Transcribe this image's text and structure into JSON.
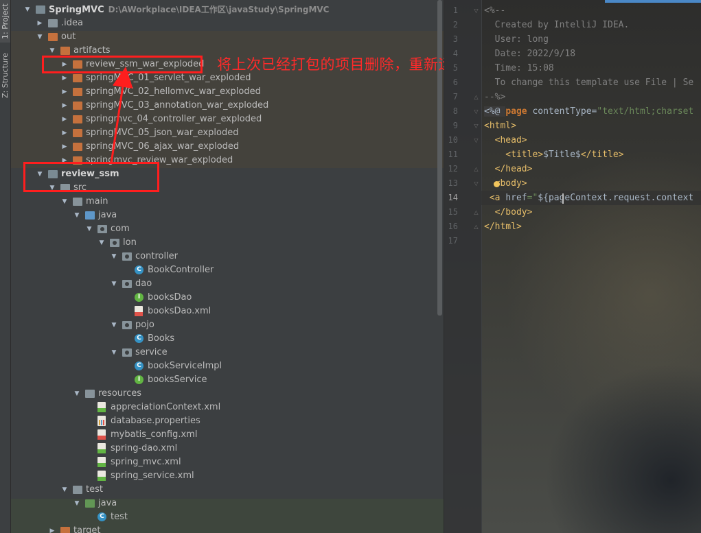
{
  "toolstrip": {
    "project_tab": "1: Project",
    "structure_tab": "Z: Structure"
  },
  "tree": {
    "rows": [
      {
        "label": "SpringMVC",
        "path": "D:\\AWorkplace\\IDEA工作区\\javaStudy\\SpringMVC",
        "kind": "module",
        "depth": 0,
        "expanded": true,
        "bold": true
      },
      {
        "label": ".idea",
        "kind": "folder",
        "depth": 1,
        "expanded": false
      },
      {
        "label": "out",
        "kind": "folder-orange",
        "depth": 1,
        "expanded": true
      },
      {
        "label": "artifacts",
        "kind": "folder-orange",
        "depth": 2,
        "expanded": true
      },
      {
        "label": "review_ssm_war_exploded",
        "kind": "folder-orange",
        "depth": 3,
        "expanded": false
      },
      {
        "label": "springMVC_01_servlet_war_exploded",
        "kind": "folder-orange",
        "depth": 3,
        "expanded": false
      },
      {
        "label": "springMVC_02_hellomvc_war_exploded",
        "kind": "folder-orange",
        "depth": 3,
        "expanded": false
      },
      {
        "label": "springMVC_03_annotation_war_exploded",
        "kind": "folder-orange",
        "depth": 3,
        "expanded": false
      },
      {
        "label": "springmvc_04_controller_war_exploded",
        "kind": "folder-orange",
        "depth": 3,
        "expanded": false
      },
      {
        "label": "springMVC_05_json_war_exploded",
        "kind": "folder-orange",
        "depth": 3,
        "expanded": false
      },
      {
        "label": "springMVC_06_ajax_war_exploded",
        "kind": "folder-orange",
        "depth": 3,
        "expanded": false
      },
      {
        "label": "springmvc_review_war_exploded",
        "kind": "folder-orange",
        "depth": 3,
        "expanded": false
      },
      {
        "label": "review_ssm",
        "kind": "module",
        "depth": 1,
        "expanded": true,
        "bold": true
      },
      {
        "label": "src",
        "kind": "folder",
        "depth": 2,
        "expanded": true
      },
      {
        "label": "main",
        "kind": "folder",
        "depth": 3,
        "expanded": true
      },
      {
        "label": "java",
        "kind": "folder-blue",
        "depth": 4,
        "expanded": true
      },
      {
        "label": "com",
        "kind": "package",
        "depth": 5,
        "expanded": true
      },
      {
        "label": "lon",
        "kind": "package",
        "depth": 6,
        "expanded": true
      },
      {
        "label": "controller",
        "kind": "package",
        "depth": 7,
        "expanded": true
      },
      {
        "label": "BookController",
        "kind": "class",
        "depth": 8
      },
      {
        "label": "dao",
        "kind": "package",
        "depth": 7,
        "expanded": true
      },
      {
        "label": "booksDao",
        "kind": "interface",
        "depth": 8
      },
      {
        "label": "booksDao.xml",
        "kind": "xml",
        "depth": 8
      },
      {
        "label": "pojo",
        "kind": "package",
        "depth": 7,
        "expanded": true
      },
      {
        "label": "Books",
        "kind": "class",
        "depth": 8
      },
      {
        "label": "service",
        "kind": "package",
        "depth": 7,
        "expanded": true
      },
      {
        "label": "bookServiceImpl",
        "kind": "class",
        "depth": 8
      },
      {
        "label": "booksService",
        "kind": "interface",
        "depth": 8
      },
      {
        "label": "resources",
        "kind": "folder-res",
        "depth": 4,
        "expanded": true
      },
      {
        "label": "appreciationContext.xml",
        "kind": "spring-xml",
        "depth": 5
      },
      {
        "label": "database.properties",
        "kind": "properties",
        "depth": 5
      },
      {
        "label": "mybatis_config.xml",
        "kind": "xml",
        "depth": 5
      },
      {
        "label": "spring-dao.xml",
        "kind": "spring-xml",
        "depth": 5
      },
      {
        "label": "spring_mvc.xml",
        "kind": "spring-xml",
        "depth": 5
      },
      {
        "label": "spring_service.xml",
        "kind": "spring-xml",
        "depth": 5
      },
      {
        "label": "test",
        "kind": "folder",
        "depth": 3,
        "expanded": true
      },
      {
        "label": "java",
        "kind": "folder-green",
        "depth": 4,
        "expanded": true
      },
      {
        "label": "test",
        "kind": "class",
        "depth": 5
      },
      {
        "label": "target",
        "kind": "folder-orange",
        "depth": 2,
        "expanded": false
      }
    ]
  },
  "annotation": {
    "text": "将上次已经打包的项目删除，重新运行项目打包"
  },
  "editor": {
    "lines": [
      {
        "n": "1",
        "tokens": [
          {
            "t": "<%--",
            "c": "c-comment"
          }
        ]
      },
      {
        "n": "2",
        "tokens": [
          {
            "t": "  Created by IntelliJ IDEA.",
            "c": "c-comment"
          }
        ]
      },
      {
        "n": "3",
        "tokens": [
          {
            "t": "  User: long",
            "c": "c-comment"
          }
        ]
      },
      {
        "n": "4",
        "tokens": [
          {
            "t": "  Date: 2022/9/18",
            "c": "c-comment"
          }
        ]
      },
      {
        "n": "5",
        "tokens": [
          {
            "t": "  Time: 15:08",
            "c": "c-comment"
          }
        ]
      },
      {
        "n": "6",
        "tokens": [
          {
            "t": "  To change this template use File | Se",
            "c": "c-comment"
          }
        ]
      },
      {
        "n": "7",
        "tokens": [
          {
            "t": "--%>",
            "c": "c-comment"
          }
        ]
      },
      {
        "n": "8",
        "tokens": [
          {
            "t": "<%@ ",
            "c": "c-dir"
          },
          {
            "t": "page ",
            "c": "c-kw"
          },
          {
            "t": "contentType",
            "c": "c-plain"
          },
          {
            "t": "=",
            "c": "c-plain"
          },
          {
            "t": "\"text/html;charset",
            "c": "c-str"
          }
        ]
      },
      {
        "n": "9",
        "tokens": [
          {
            "t": "<html>",
            "c": "c-tag"
          }
        ]
      },
      {
        "n": "10",
        "tokens": [
          {
            "t": "  <head>",
            "c": "c-tag"
          }
        ]
      },
      {
        "n": "11",
        "tokens": [
          {
            "t": "    <title>",
            "c": "c-tag"
          },
          {
            "t": "$Title$",
            "c": "c-plain"
          },
          {
            "t": "</title>",
            "c": "c-tag"
          }
        ]
      },
      {
        "n": "12",
        "tokens": [
          {
            "t": "  </head>",
            "c": "c-tag"
          }
        ]
      },
      {
        "n": "13",
        "tokens": [
          {
            "t": "  <body>",
            "c": "c-tag"
          }
        ]
      },
      {
        "n": "14",
        "tokens": [
          {
            "t": " <a ",
            "c": "c-tag"
          },
          {
            "t": "href",
            "c": "c-plain"
          },
          {
            "t": "=\"",
            "c": "c-str"
          },
          {
            "t": "${",
            "c": "c-plain"
          },
          {
            "t": "pageContext.request.context",
            "c": "c-plain"
          }
        ]
      },
      {
        "n": "15",
        "tokens": [
          {
            "t": "  </body>",
            "c": "c-tag"
          }
        ]
      },
      {
        "n": "16",
        "tokens": [
          {
            "t": "</html>",
            "c": "c-tag"
          }
        ]
      },
      {
        "n": "17",
        "tokens": [
          {
            "t": "",
            "c": "c-plain"
          }
        ]
      }
    ]
  }
}
